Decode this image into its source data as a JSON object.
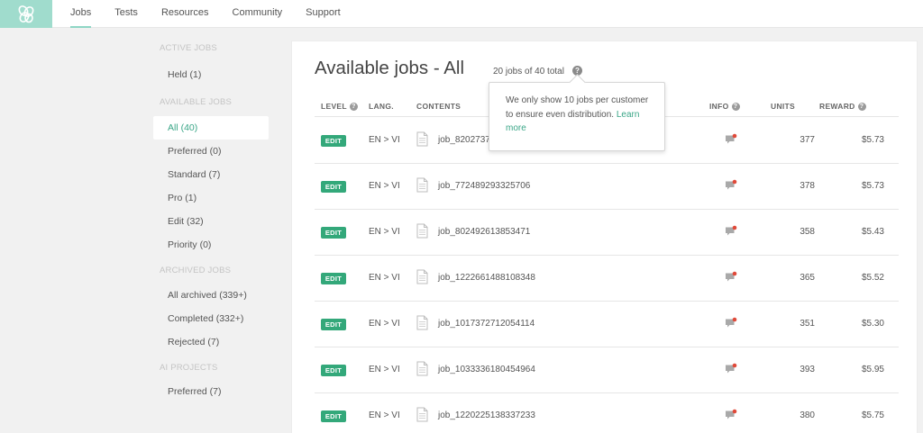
{
  "nav": {
    "items": [
      {
        "label": "Jobs",
        "active": true
      },
      {
        "label": "Tests",
        "active": false
      },
      {
        "label": "Resources",
        "active": false
      },
      {
        "label": "Community",
        "active": false
      },
      {
        "label": "Support",
        "active": false
      }
    ]
  },
  "sidebar": {
    "active_heading": "ACTIVE JOBS",
    "active_items": [
      "Held (1)"
    ],
    "available_heading": "AVAILABLE JOBS",
    "available_items": [
      "All (40)",
      "Preferred (0)",
      "Standard (7)",
      "Pro (1)",
      "Edit (32)",
      "Priority (0)"
    ],
    "archived_heading": "ARCHIVED JOBS",
    "archived_items": [
      "All archived (339+)",
      "Completed (332+)",
      "Rejected (7)"
    ],
    "ai_heading": "AI PROJECTS",
    "ai_items": [
      "Preferred (7)"
    ]
  },
  "main": {
    "title": "Available jobs - All",
    "count_text": "20 jobs of 40 total",
    "help_glyph": "?",
    "columns": {
      "level": "LEVEL",
      "lang": "LANG.",
      "contents": "CONTENTS",
      "info": "INFO",
      "units": "UNITS",
      "reward": "REWARD"
    }
  },
  "tooltip": {
    "text": "We only show 10 jobs per customer to ensure even distribution.",
    "link": "Learn more"
  },
  "jobs": [
    {
      "level": "EDIT",
      "lang": "EN > VI",
      "name": "job_8202737",
      "units": "377",
      "reward": "$5.73"
    },
    {
      "level": "EDIT",
      "lang": "EN > VI",
      "name": "job_772489293325706",
      "units": "378",
      "reward": "$5.73"
    },
    {
      "level": "EDIT",
      "lang": "EN > VI",
      "name": "job_802492613853471",
      "units": "358",
      "reward": "$5.43"
    },
    {
      "level": "EDIT",
      "lang": "EN > VI",
      "name": "job_1222661488108348",
      "units": "365",
      "reward": "$5.52"
    },
    {
      "level": "EDIT",
      "lang": "EN > VI",
      "name": "job_1017372712054114",
      "units": "351",
      "reward": "$5.30"
    },
    {
      "level": "EDIT",
      "lang": "EN > VI",
      "name": "job_1033336180454964",
      "units": "393",
      "reward": "$5.95"
    },
    {
      "level": "EDIT",
      "lang": "EN > VI",
      "name": "job_1220225138337233",
      "units": "380",
      "reward": "$5.75"
    }
  ],
  "colors": {
    "accent": "#3aa687",
    "badge": "#33a87a",
    "logo_bg": "#a0dccd",
    "notify_dot": "#e04a3a"
  },
  "icons": {
    "logo": "flower-logo-icon",
    "doc": "document-icon",
    "info": "comment-icon",
    "help": "question-icon"
  }
}
